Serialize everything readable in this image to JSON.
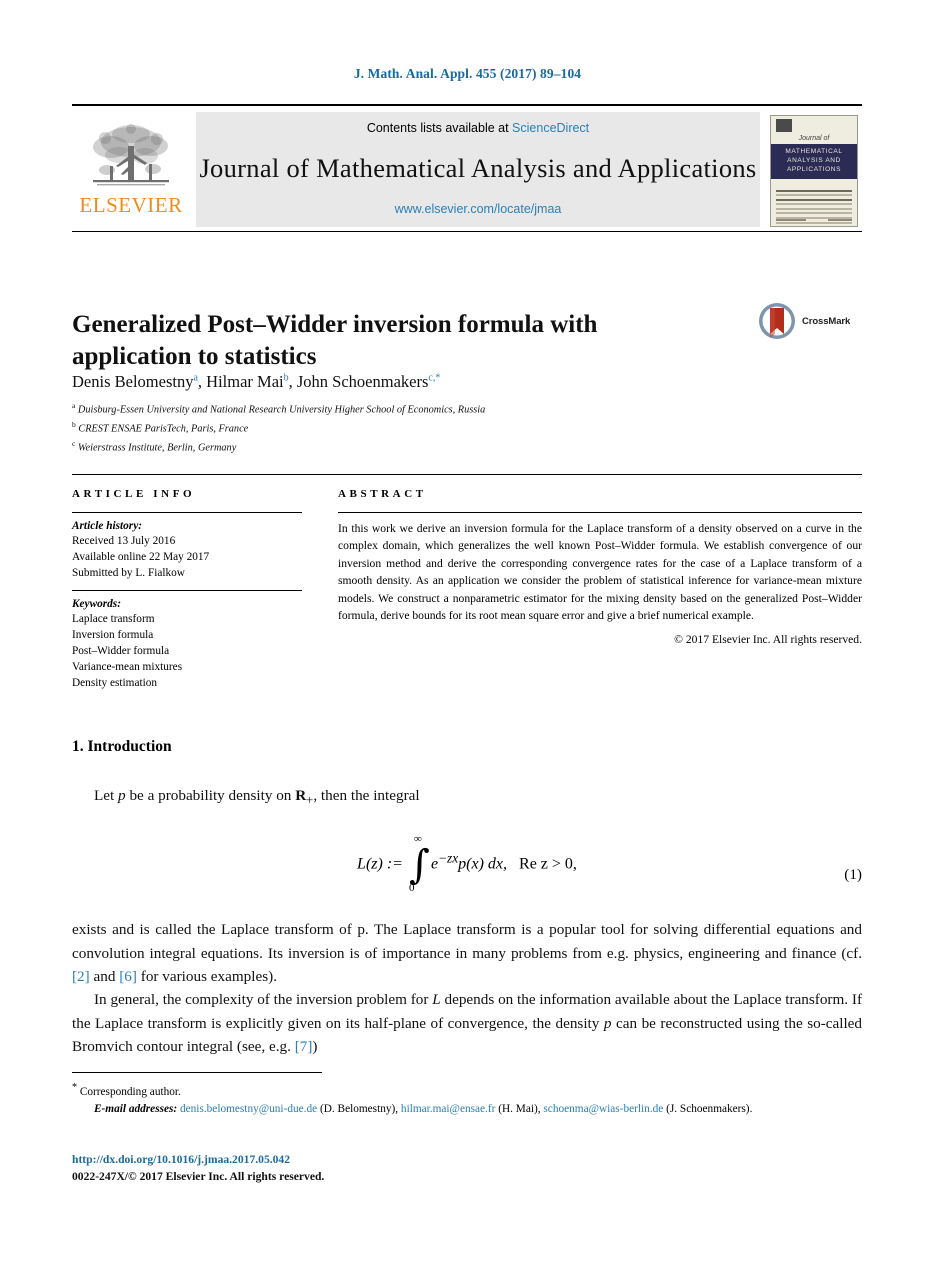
{
  "running_head": "J. Math. Anal. Appl. 455 (2017) 89–104",
  "masthead": {
    "contents_prefix": "Contents lists available at ",
    "sciencedirect": "ScienceDirect",
    "journal_name": "Journal of Mathematical Analysis and Applications",
    "locate_url": "www.elsevier.com/locate/jmaa",
    "publisher": "ELSEVIER",
    "cover": {
      "journal_of": "Journal of",
      "band_line1": "MATHEMATICAL",
      "band_line2": "ANALYSIS AND",
      "band_line3": "APPLICATIONS"
    }
  },
  "article": {
    "title": "Generalized Post–Widder inversion formula with application to statistics",
    "crossmark_label": "CrossMark",
    "authors": [
      {
        "name": "Denis Belomestny",
        "marks": "a"
      },
      {
        "name": "Hilmar Mai",
        "marks": "b"
      },
      {
        "name": "John Schoenmakers",
        "marks": "c,*"
      }
    ],
    "affiliations": [
      {
        "mark": "a",
        "text": "Duisburg-Essen University and National Research University Higher School of Economics, Russia"
      },
      {
        "mark": "b",
        "text": "CREST ENSAE ParisTech, Paris, France"
      },
      {
        "mark": "c",
        "text": "Weierstrass Institute, Berlin, Germany"
      }
    ]
  },
  "info": {
    "heading": "ARTICLE INFO",
    "history_title": "Article history:",
    "history": [
      "Received 13 July 2016",
      "Available online 22 May 2017",
      "Submitted by L. Fialkow"
    ],
    "keywords_title": "Keywords:",
    "keywords": [
      "Laplace transform",
      "Inversion formula",
      "Post–Widder formula",
      "Variance-mean mixtures",
      "Density estimation"
    ]
  },
  "abstract": {
    "heading": "ABSTRACT",
    "text": "In this work we derive an inversion formula for the Laplace transform of a density observed on a curve in the complex domain, which generalizes the well known Post–Widder formula. We establish convergence of our inversion method and derive the corresponding convergence rates for the case of a Laplace transform of a smooth density. As an application we consider the problem of statistical inference for variance-mean mixture models. We construct a nonparametric estimator for the mixing density based on the generalized Post–Widder formula, derive bounds for its root mean square error and give a brief numerical example.",
    "copyright": "© 2017 Elsevier Inc. All rights reserved."
  },
  "body": {
    "section_title": "1. Introduction",
    "paragraph1_pre": "Let ",
    "paragraph1_p": "p",
    "paragraph1_post": " be a probability density on ",
    "paragraph1_rplus": "R",
    "paragraph1_sub": "+",
    "paragraph1_end": ", then the integral",
    "equation": {
      "lhs": "L(z) :=",
      "upper": "∞",
      "lower": "0",
      "integrand": "e",
      "exponent": "−zx",
      "density": "p(x) dx,",
      "condition": "Re z > 0,",
      "number": "(1)"
    },
    "paragraph2": "exists and is called the Laplace transform of p. The Laplace transform is a popular tool for solving differential equations and convolution integral equations. Its inversion is of importance in many problems from e.g. physics, engineering and finance (cf.",
    "paragraph2_cite1": "[2]",
    "paragraph2_mid": "and",
    "paragraph2_cite2": "[6]",
    "paragraph2_end": "for various examples).",
    "paragraph3_a": "In general, the complexity of the inversion problem for",
    "paragraph3_L": "L",
    "paragraph3_b": "depends on the information available about the Laplace transform. If the Laplace transform is explicitly given on its half-plane of convergence, the density",
    "paragraph3_p": "p",
    "paragraph3_c": "can be reconstructed using the so-called Bromvich contour integral (see, e.g.",
    "paragraph3_cite": "[7]",
    "paragraph3_d": ")"
  },
  "footnotes": {
    "corresponding_mark": "*",
    "corresponding": "Corresponding author.",
    "email_label": "E-mail addresses:",
    "emails": [
      {
        "address": "denis.belomestny@uni-due.de",
        "owner": "(D. Belomestny),"
      },
      {
        "address": "hilmar.mai@ensae.fr",
        "owner": "(H. Mai),"
      },
      {
        "address": "schoenma@wias-berlin.de",
        "owner": ""
      }
    ],
    "emails_tail": "(J. Schoenmakers).",
    "doi": "http://dx.doi.org/10.1016/j.jmaa.2017.05.042",
    "issn": "0022-247X/© 2017 Elsevier Inc. All rights reserved."
  }
}
